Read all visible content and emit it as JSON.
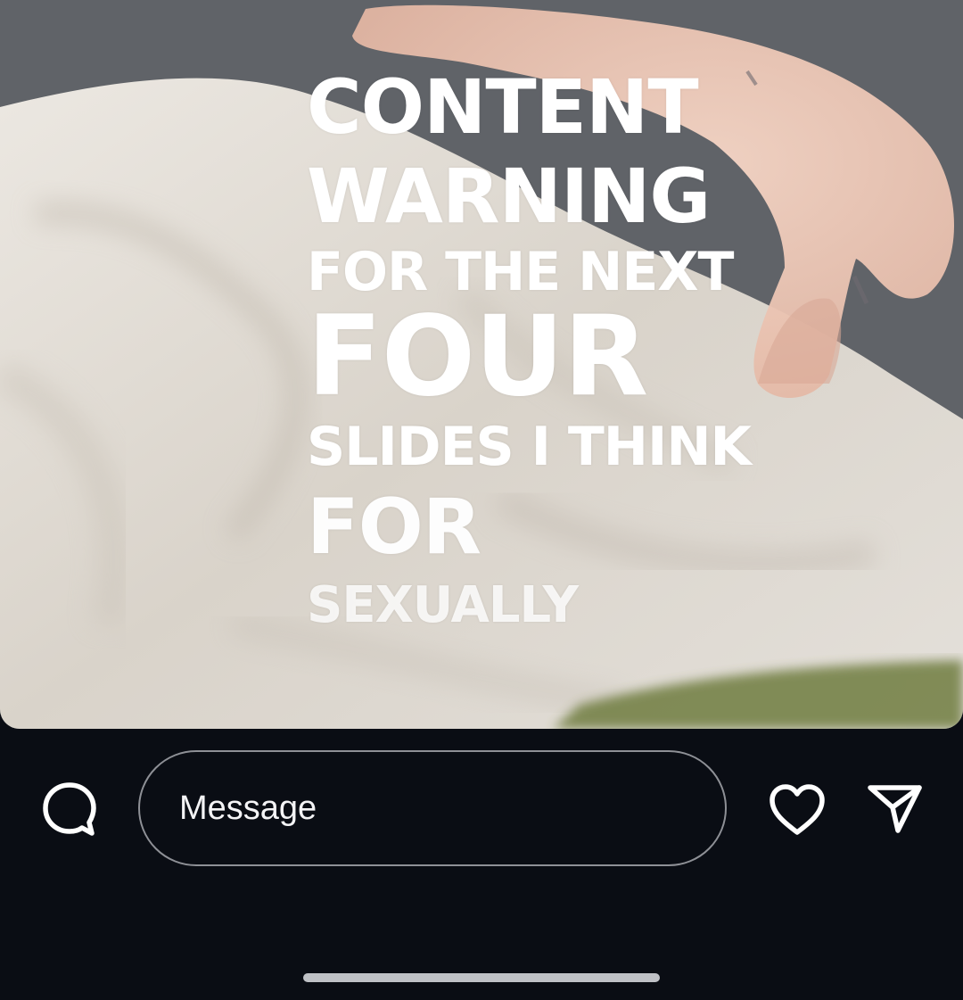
{
  "story": {
    "overlay_lines": [
      "CONTENT",
      "WARNING",
      "FOR THE NEXT",
      "FOUR",
      "SLIDES I THINK",
      "FOR",
      "SEXUALLY"
    ]
  },
  "reply_bar": {
    "message_placeholder": "Message",
    "icons": {
      "comment": "speech-bubble-icon",
      "like": "heart-icon",
      "share": "paper-plane-icon"
    }
  },
  "colors": {
    "background": "#0a0d14",
    "input_border": "#8e9096",
    "text": "#f4f4f6",
    "home_indicator": "#bfc1c6"
  }
}
